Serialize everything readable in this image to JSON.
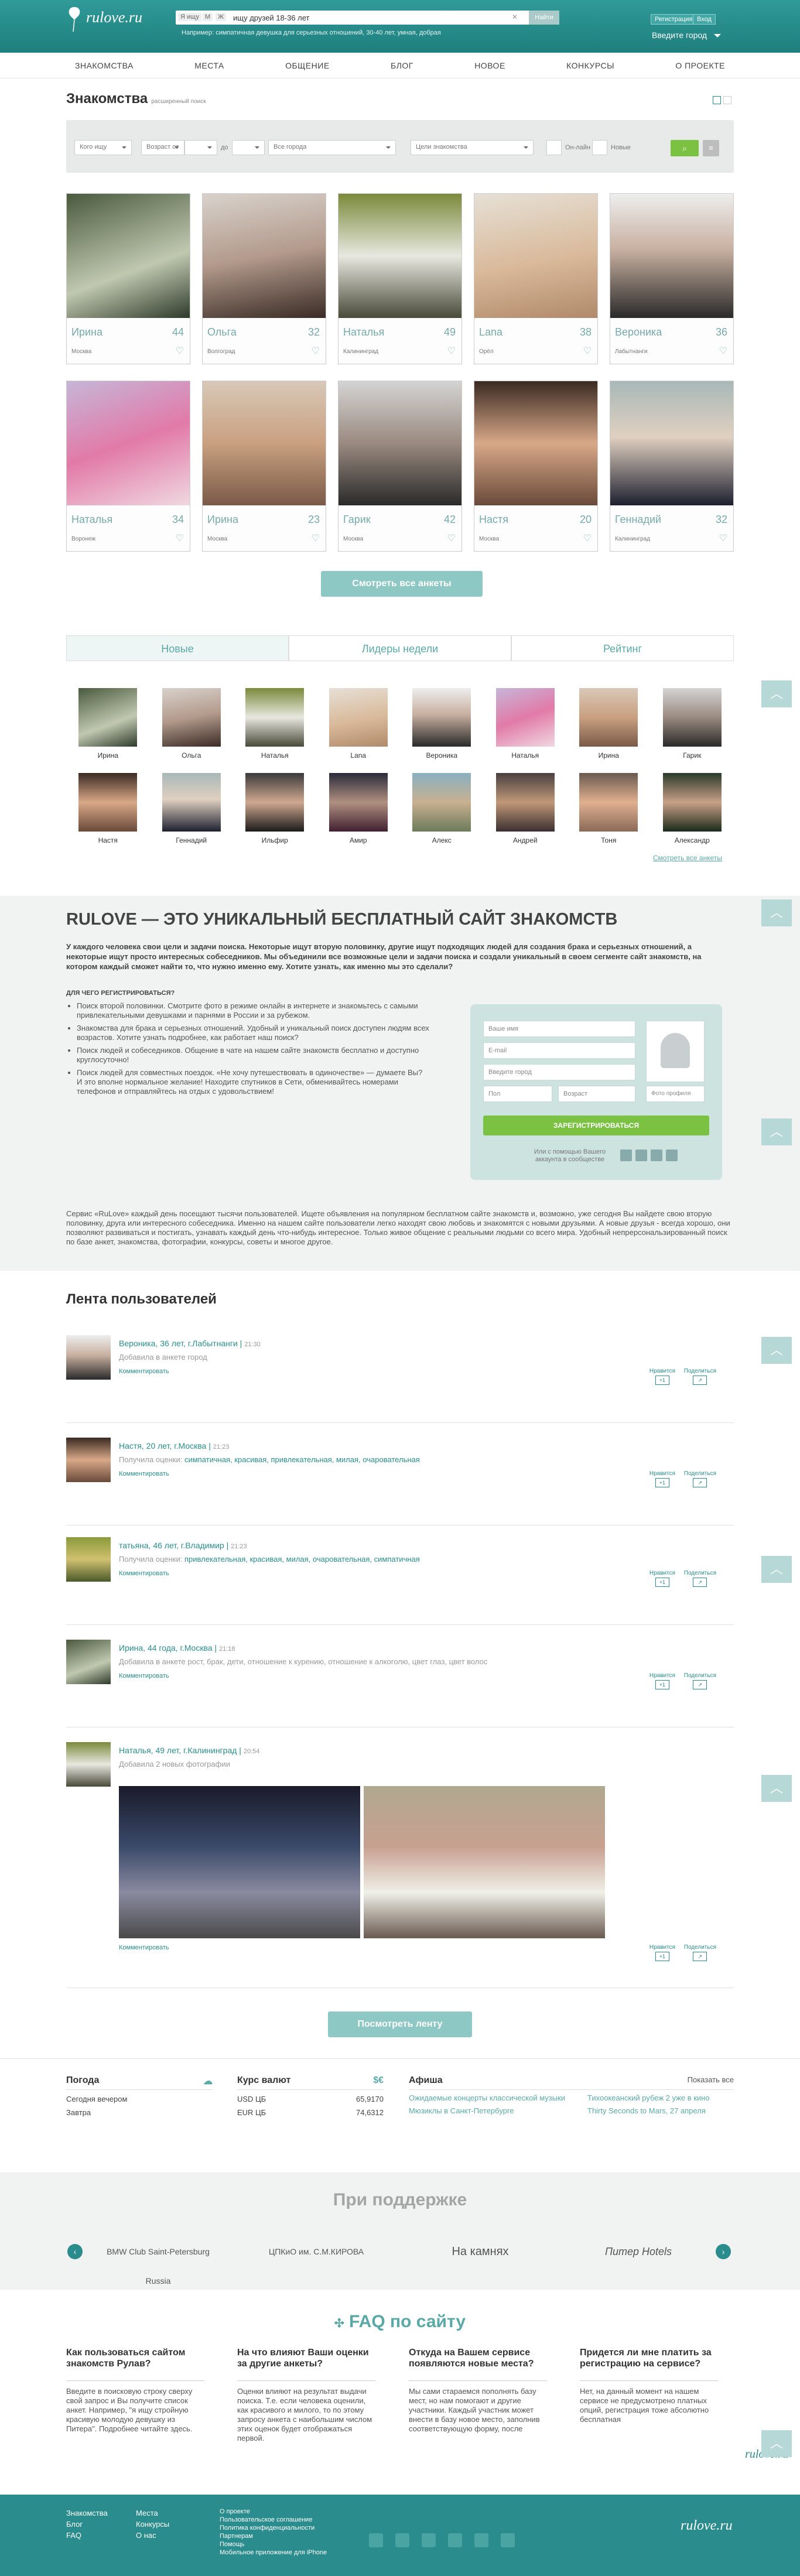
{
  "header": {
    "logo": "rulove.ru",
    "search_tags": [
      "Я ищу",
      "М",
      "Ж"
    ],
    "search_value": "ищу друзей 18-36 лет",
    "search_button": "Найти",
    "search_example": "Например: симпатичная девушка для серьезных отношений, 30-40 лет, умная, добрая",
    "register_label": "Регистрация",
    "login_label": "Вход",
    "city_label": "Введите город"
  },
  "nav": [
    "ЗНАКОМСТВА",
    "МЕСТА",
    "ОБЩЕНИЕ",
    "БЛОГ",
    "НОВОЕ",
    "КОНКУРСЫ",
    "О ПРОЕКТЕ"
  ],
  "dating": {
    "title": "Знакомства",
    "subtitle": "расширенный поиск",
    "filters": {
      "who": "Кого ищу",
      "age_from": "Возраст от",
      "to": "до",
      "city": "Все города",
      "goal": "Цели знакомства",
      "online": "Он-лайн",
      "new": "Новые"
    },
    "cards_row1": [
      {
        "name": "Ирина",
        "age": "44",
        "city": "Москва"
      },
      {
        "name": "Ольга",
        "age": "32",
        "city": "Волгоград"
      },
      {
        "name": "Наталья",
        "age": "49",
        "city": "Калининград"
      },
      {
        "name": "Lana",
        "age": "38",
        "city": "Орёл"
      },
      {
        "name": "Вероника",
        "age": "36",
        "city": "Лабытнанги"
      }
    ],
    "cards_row2": [
      {
        "name": "Наталья",
        "age": "34",
        "city": "Воронеж"
      },
      {
        "name": "Ирина",
        "age": "23",
        "city": "Москва"
      },
      {
        "name": "Гарик",
        "age": "42",
        "city": "Москва"
      },
      {
        "name": "Настя",
        "age": "20",
        "city": "Москва"
      },
      {
        "name": "Геннадий",
        "age": "32",
        "city": "Калининград"
      }
    ],
    "all_button": "Смотреть все анкеты"
  },
  "tabs": [
    "Новые",
    "Лидеры недели",
    "Рейтинг"
  ],
  "thumbs_row1": [
    "Ирина",
    "Ольга",
    "Наталья",
    "Lana",
    "Вероника",
    "Наталья",
    "Ирина",
    "Гарик"
  ],
  "thumbs_row2": [
    "Настя",
    "Геннадий",
    "Ильфир",
    "Амир",
    "Алекс",
    "Андрей",
    "Тоня",
    "Александр"
  ],
  "all_profiles_link": "Смотреть все анкеты",
  "about": {
    "title": "RULOVE — ЭТО УНИКАЛЬНЫЙ БЕСПЛАТНЫЙ САЙТ ЗНАКОМСТВ",
    "lead": "У каждого человека свои цели и задачи поиска. Некоторые ищут вторую половинку, другие ищут подходящих людей для создания брака и серьезных отношений, а некоторые ищут просто интересных собеседников. Мы объединили все возможные цели и задачи поиска и создали уникальный в своем сегменте сайт знакомств, на котором каждый сможет найти то, что нужно именно ему. Хотите узнать, как именно мы это сделали?",
    "why_title": "ДЛЯ ЧЕГО РЕГИСТРИРОВАТЬСЯ?",
    "why": [
      "Поиск второй половинки. Смотрите фото в режиме онлайн в интернете и знакомьтесь с самыми привлекательными девушками и парнями в России и за рубежом.",
      "Знакомства для брака и серьезных отношений. Удобный и уникальный поиск доступен людям всех возрастов. Хотите узнать подробнее, как работает наш поиск?",
      "Поиск людей и собеседников. Общение в чате на нашем сайте знакомств бесплатно и доступно круглосуточно!",
      "Поиск людей для совместных поездок. «Не хочу путешествовать в одиночестве» — думаете Вы? И это вполне нормальное желание! Находите спутников в Сети, обменивайтесь номерами телефонов и отправляйтесь на отдых с удовольствием!"
    ],
    "bottom": "Сервис «RuLove» каждый день посещают тысячи пользователей. Ищете объявления на популярном бесплатном сайте знакомств и, возможно, уже сегодня Вы найдете свою вторую половинку, друга или интересного собеседника. Именно на нашем сайте пользователи легко находят свою любовь и знакомятся с новыми друзьями. А новые друзья - всегда хорошо, они позволяют развиваться и постигать, узнавать каждый день что-нибудь интересное. Только живое общение с реальными людьми со всего мира. Удобный непрерсональзированный поиск по базе анкет, знакомства, фотографии, конкурсы, советы и многое другое.",
    "form": {
      "name": "Ваше имя",
      "email": "E-mail",
      "city": "Введите город",
      "sex": "Пол",
      "age": "Возраст",
      "photo": "Фото профиля",
      "submit": "ЗАРЕГИСТРИРОВАТЬСЯ",
      "social": "Или с помощью Вашего аккаунта в сообществе"
    }
  },
  "feed": {
    "title": "Лента пользователей",
    "items": [
      {
        "who": "Вероника, 36 лет, г.Лабытнанги",
        "time": "21:30",
        "act_pre": "Добавила в анкете город",
        "act_link": "",
        "comment": "Комментировать",
        "like": "Нравится",
        "share": "Поделиться"
      },
      {
        "who": "Настя, 20 лет, г.Москва",
        "time": "21:23",
        "act_pre": "Получила оценки:",
        "act_link": "симпатичная, красивая, привлекательная, милая, очаровательная",
        "comment": "Комментировать",
        "like": "Нравится",
        "share": "Поделиться"
      },
      {
        "who": "татьяна, 46 лет, г.Владимир",
        "time": "21:23",
        "act_pre": "Получила оценки:",
        "act_link": "привлекательная, красивая, милая, очаровательная, симпатичная",
        "comment": "Комментировать",
        "like": "Нравится",
        "share": "Поделиться"
      },
      {
        "who": "Ирина, 44 года, г.Москва",
        "time": "21:18",
        "act_pre": "Добавила в анкете рост, брак, дети, отношение к курению, отношение к алкоголю, цвет глаз, цвет волос",
        "act_link": "",
        "comment": "Комментировать",
        "like": "Нравится",
        "share": "Поделиться"
      },
      {
        "who": "Наталья, 49 лет, г.Калининград",
        "time": "20:54",
        "act_pre": "Добавила 2 новых фотографии",
        "act_link": "",
        "comment": "Комментировать",
        "like": "Нравится",
        "share": "Поделиться"
      }
    ],
    "button": "Посмотреть ленту"
  },
  "weather": {
    "title": "Погода",
    "rows": [
      [
        "Сегодня вечером",
        ""
      ],
      [
        "Завтра",
        ""
      ]
    ]
  },
  "currency": {
    "title": "Курс валют",
    "rows": [
      [
        "USD ЦБ",
        "65,9170"
      ],
      [
        "EUR ЦБ",
        "74,6312"
      ]
    ]
  },
  "afisha": {
    "title": "Афиша",
    "show_all": "Показать все",
    "items": [
      "Ожидаемые концерты классической музыки",
      "Тихоокеанский рубеж 2 уже в кино",
      "Мюзиклы в Санкт-Петербурге",
      "Thirty Seconds to Mars, 27 апреля"
    ]
  },
  "partners": {
    "title": "При поддержке",
    "logos": [
      "BMW Club Saint-Petersburg Russia",
      "ЦПКиО им. С.М.КИРОВА",
      "На камнях",
      "Питер Hotels"
    ]
  },
  "faq": {
    "title": "FAQ по сайту",
    "items": [
      {
        "q": "Как пользоваться сайтом знакомств Рулав?",
        "a": "Введите в поисковую строку сверху свой запрос и Вы получите список анкет. Например, \"я ищу стройную красивую молодую девушку из Питера\". Подробнее читайте здесь."
      },
      {
        "q": "На что влияют Ваши оценки за другие анкеты?",
        "a": "Оценки влияют на результат выдачи поиска. Т.е. если человека оценили, как красивого и милого, то по этому запросу анкета с наибольшим числом этих оценок будет отображаться первой."
      },
      {
        "q": "Откуда на Вашем сервисе появляются новые места?",
        "a": "Мы сами стараемся пополнять базу мест, но нам помогают и другие участники. Каждый участник может внести в базу новое место, заполнив соответствующую форму, после"
      },
      {
        "q": "Придется ли мне платить за регистрацию на сервисе?",
        "a": "Нет, на данный момент на нашем сервисе не предусмотрено платных опций, регистрация тоже абсолютно бесплатная"
      }
    ]
  },
  "footer": {
    "col1": [
      "Знакомства",
      "Блог",
      "FAQ"
    ],
    "col2": [
      "Места",
      "Конкурсы",
      "О нас"
    ],
    "col3": [
      "О проекте",
      "Пользовательское соглашение",
      "Политика конфиденциальности",
      "Партнерам",
      "Помощь",
      "Мобильное приложение для iPhone"
    ],
    "logo": "rulove.ru"
  }
}
